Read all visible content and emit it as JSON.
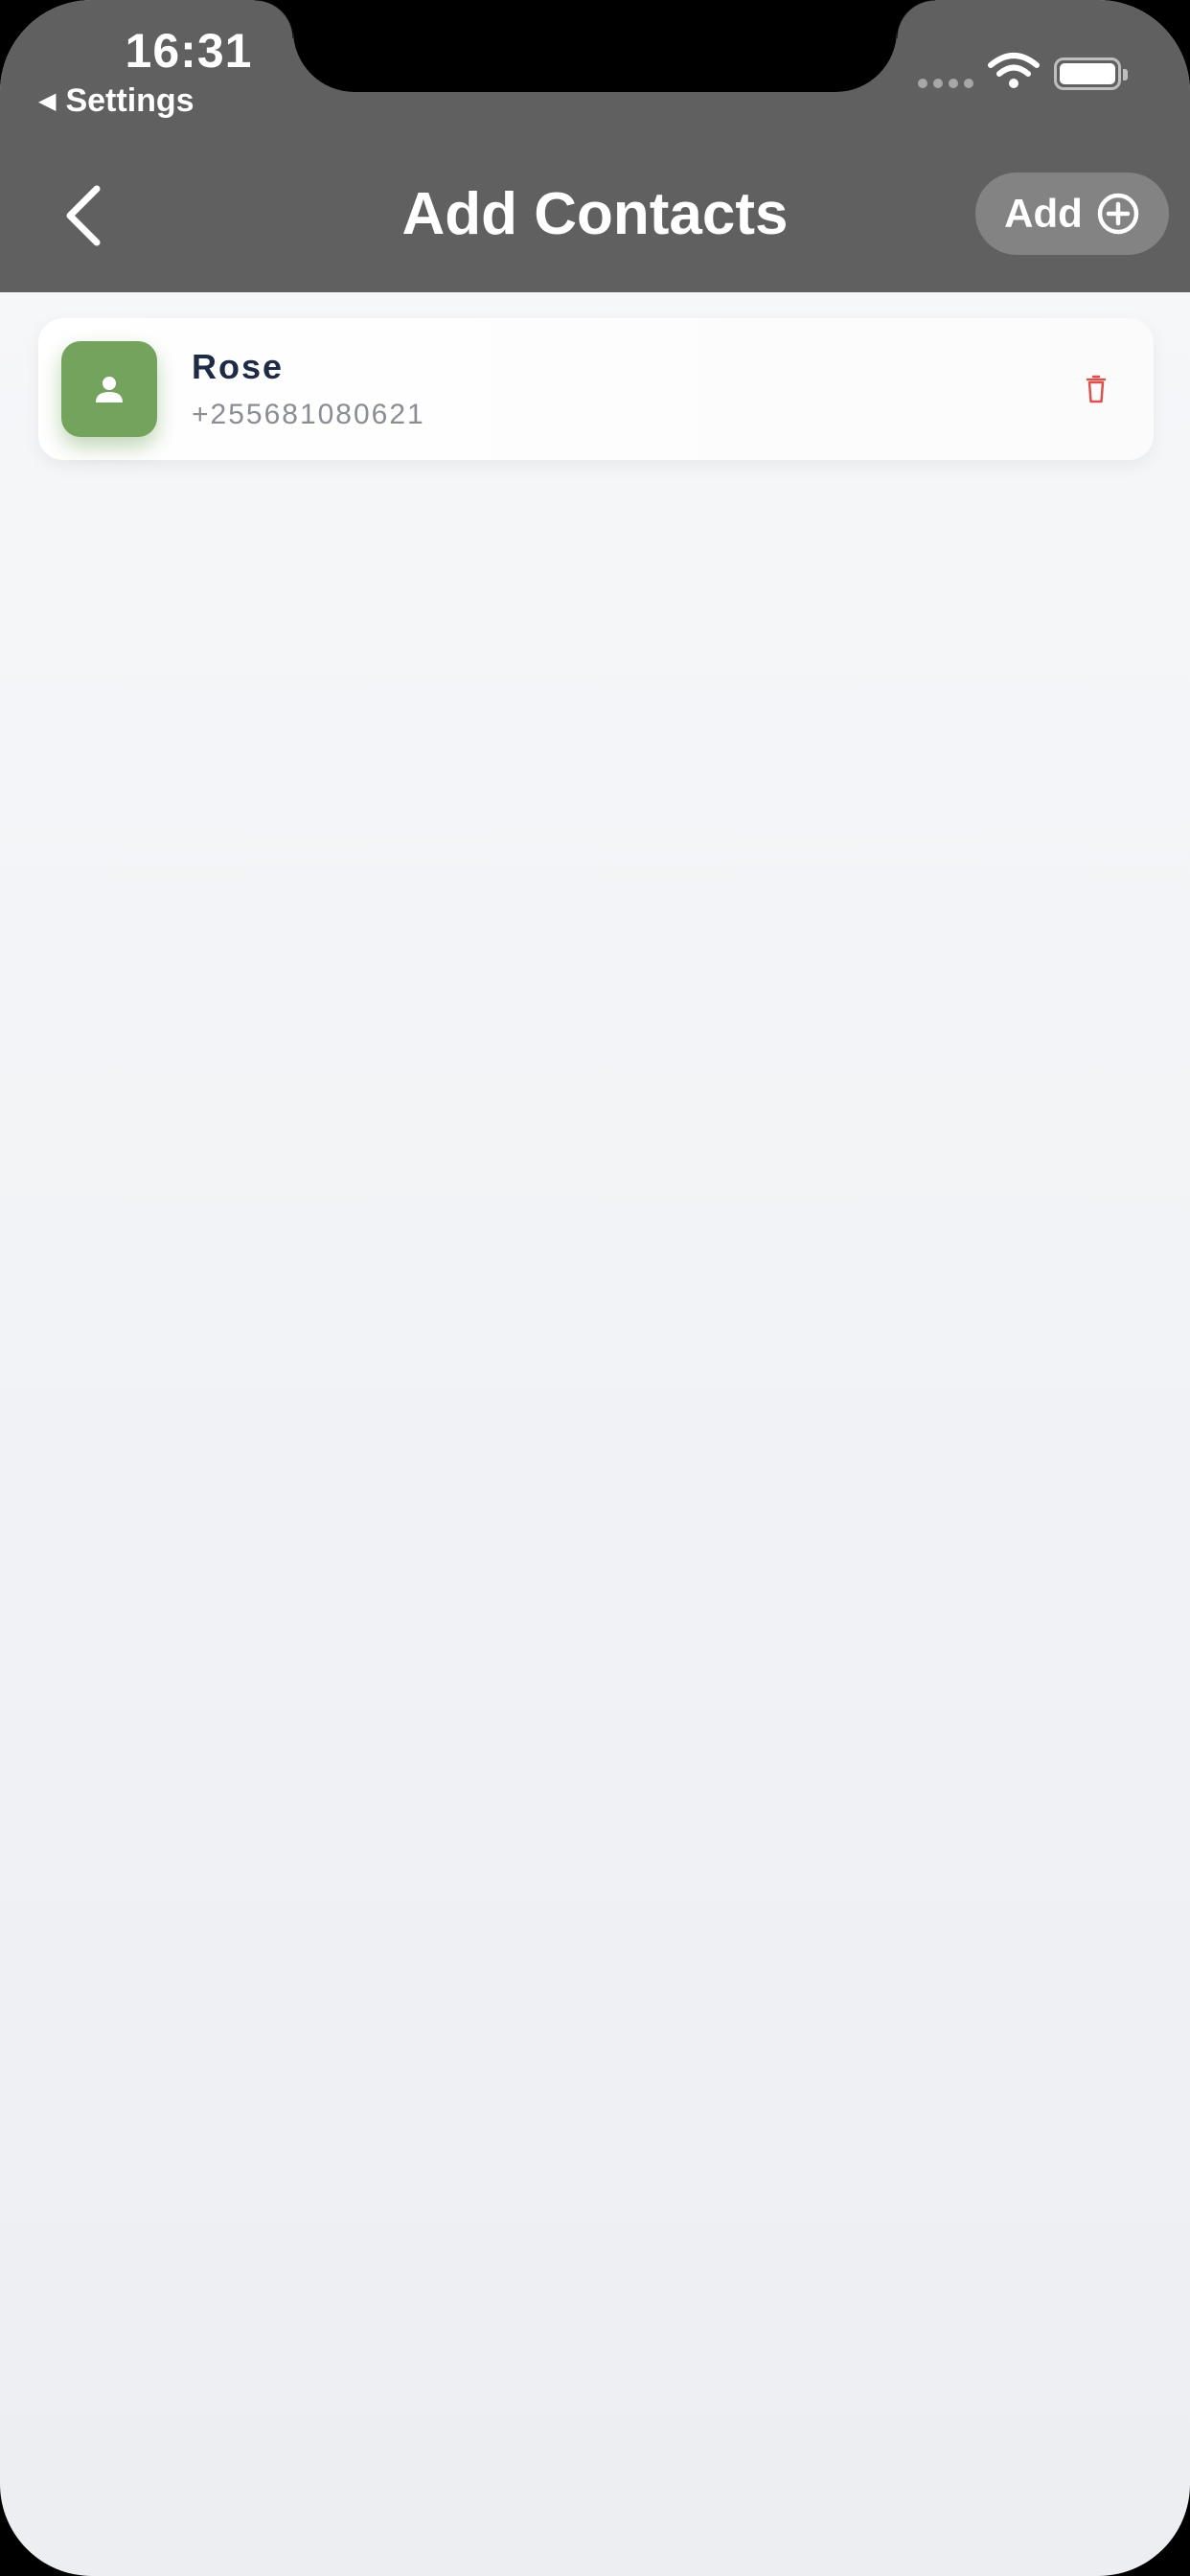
{
  "status_bar": {
    "time": "16:31",
    "back_app": "Settings",
    "back_glyph": "◀",
    "icons": [
      "signal-dots-icon",
      "wifi-icon",
      "battery-icon"
    ]
  },
  "header": {
    "title": "Add Contacts",
    "back_icon": "chevron-left-icon",
    "add_label": "Add",
    "add_icon": "plus-circle-icon",
    "background": "#606060"
  },
  "contacts": [
    {
      "name": "Rose",
      "phone": "+255681080621",
      "avatar_icon": "person-icon",
      "avatar_color": "#74a35d",
      "delete_icon": "trash-icon",
      "delete_color": "#d9534f"
    }
  ]
}
